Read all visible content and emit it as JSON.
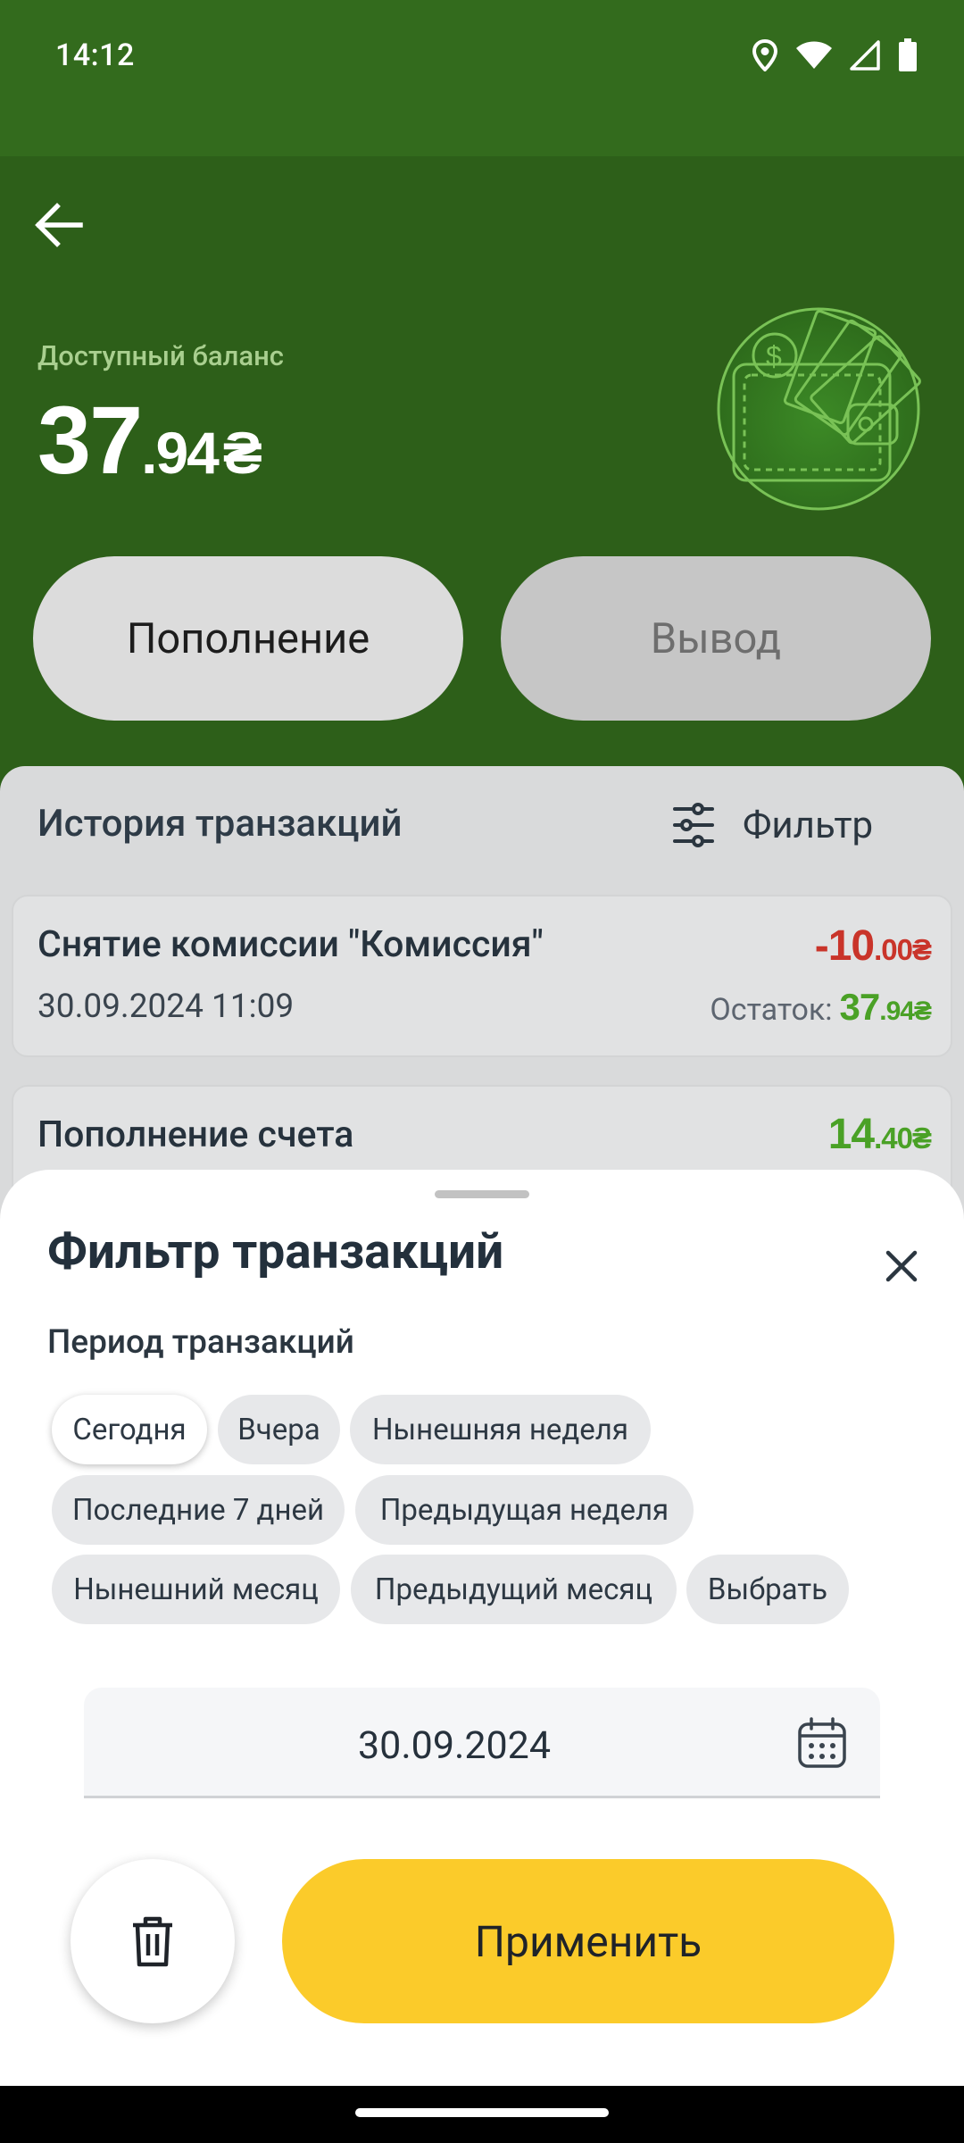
{
  "status_bar": {
    "time": "14:12",
    "icons": [
      "location-icon",
      "wifi-icon",
      "signal-icon",
      "battery-icon"
    ]
  },
  "header": {
    "back_icon": "arrow-left-icon",
    "balance_label": "Доступный баланс",
    "balance_int": "37",
    "balance_dec": ".94",
    "currency": "₴",
    "illustration": "wallet-money-icon"
  },
  "actions": {
    "topup_label": "Пополнение",
    "withdraw_label": "Вывод"
  },
  "transactions": {
    "title": "История транзакций",
    "filter_label": "Фильтр",
    "items": [
      {
        "name": "Снятие комиссии \"Комиссия\"",
        "date": "30.09.2024 11:09",
        "amount_int": "-10",
        "amount_dec": ".00",
        "currency": "₴",
        "rest_label": "Остаток:",
        "rest_int": "37",
        "rest_dec": ".94"
      },
      {
        "name": "Пополнение счета",
        "amount_int": "14",
        "amount_dec": ".40",
        "currency": "₴"
      }
    ]
  },
  "filter_sheet": {
    "title": "Фильтр транзакций",
    "period_label": "Период транзакций",
    "chips": [
      "Сегодня",
      "Вчера",
      "Нынешняя неделя",
      "Последние 7 дней",
      "Предыдущая неделя",
      "Нынешний месяц",
      "Предыдущий месяц",
      "Выбрать"
    ],
    "selected_chip": "Сегодня",
    "date_value": "30.09.2024",
    "apply_label": "Применить"
  },
  "colors": {
    "header_green": "#2d5f19",
    "negative": "#c9342a",
    "positive": "#4aa126",
    "apply_yellow": "#fbcb2a"
  }
}
